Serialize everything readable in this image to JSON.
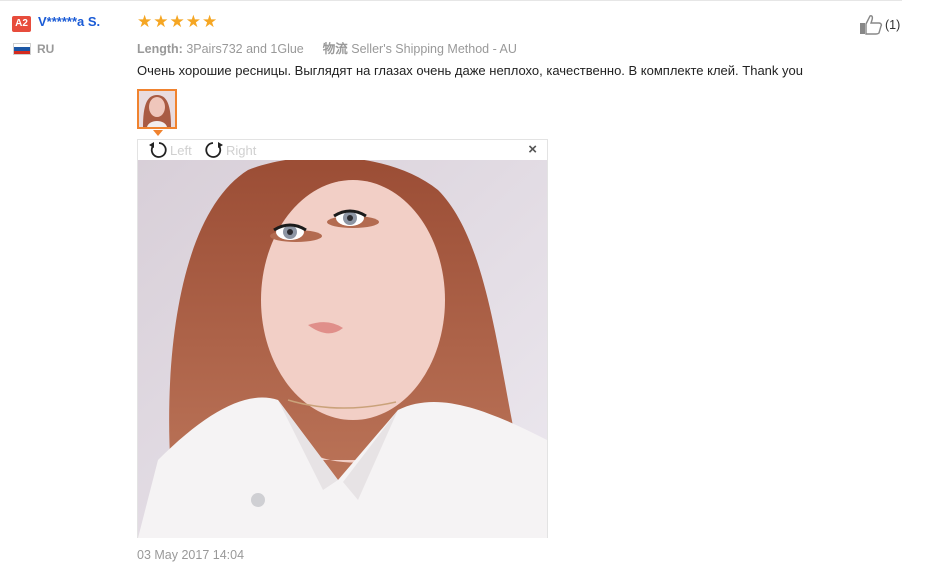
{
  "reviewer": {
    "level_badge": "A2",
    "name": "V******a S.",
    "country": "RU",
    "flag_colors": [
      "#ffffff",
      "#1c57a5",
      "#d52b1e"
    ]
  },
  "rating": {
    "stars": 5,
    "max": 5,
    "star_color": "#f5a623"
  },
  "attributes": {
    "length_label": "Length:",
    "length_value": "3Pairs732 and 1Glue",
    "logistics_label": "物流",
    "logistics_value": "Seller's Shipping Method - AU"
  },
  "review_text": "Очень хорошие ресницы. Выглядят на глазах очень даже неплохо, качественно. В комплекте клей. Thank you",
  "viewer": {
    "rotate_left_label": "Left",
    "rotate_right_label": "Right",
    "close_glyph": "×"
  },
  "timestamp": "03 May 2017 14:04",
  "helpful": {
    "count_text": "(1)",
    "icon": "thumbs-up-icon"
  },
  "colors": {
    "link": "#1a5bd6",
    "accent": "#f0832f",
    "badge": "#e74c3c",
    "muted": "#999999"
  }
}
